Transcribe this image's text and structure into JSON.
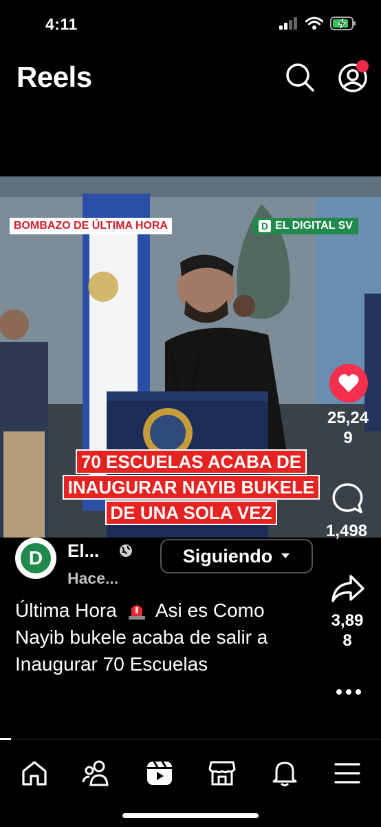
{
  "status_bar": {
    "time": "4:11"
  },
  "header": {
    "title": "Reels"
  },
  "video": {
    "breaking_tag": "BOMBAZO DE ÚLTIMA HORA",
    "brand_tag": "EL DIGITAL SV",
    "brand_letter": "D",
    "headline_lines": [
      "70 ESCUELAS ACABA DE",
      "INAUGURAR NAYIB BUKELE",
      "DE UNA SOLA VEZ"
    ]
  },
  "actions": {
    "likes": "25,24\n9",
    "likes_line1": "25,24",
    "likes_line2": "9",
    "comments": "1,498",
    "shares_line1": "3,89",
    "shares_line2": "8"
  },
  "author": {
    "avatar_letter": "D",
    "name": "El...",
    "time": "Hace...",
    "follow_label": "Siguiendo"
  },
  "caption": {
    "line1_a": "Última Hora",
    "line1_b": "Asi es",
    "rest": "Como Nayib bukele acaba de salir a Inaugurar 70 Escuelas"
  },
  "colors": {
    "accent_red": "#f4304e",
    "brand_green": "#1f8a4c",
    "headline_red": "#e52321"
  }
}
